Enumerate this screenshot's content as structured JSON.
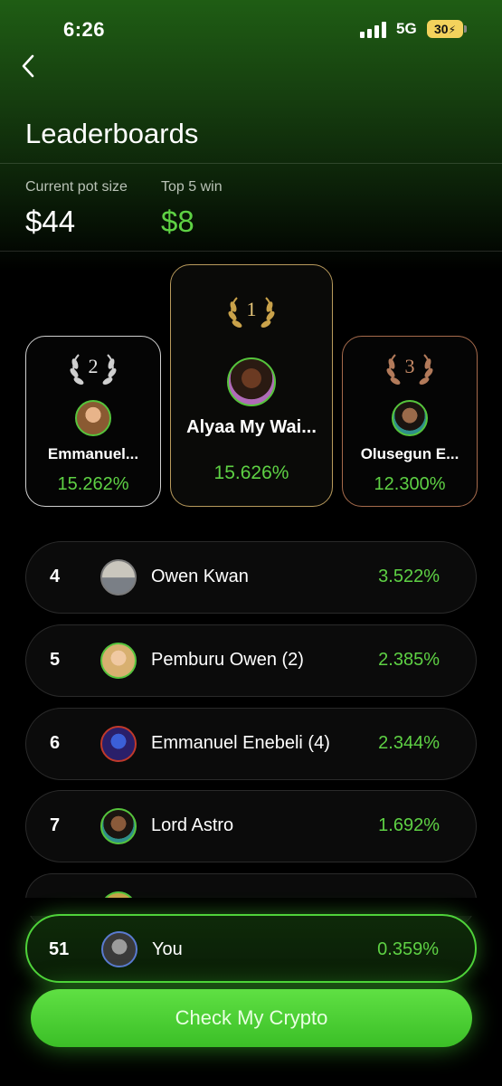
{
  "status_bar": {
    "time": "6:26",
    "network": "5G",
    "battery": "30"
  },
  "header": {
    "title": "Leaderboards"
  },
  "stats": {
    "pot_label": "Current pot size",
    "pot_value": "$44",
    "top5_label": "Top 5 win",
    "top5_value": "$8"
  },
  "podium": [
    {
      "rank": "1",
      "name": "Alyaa My Wai...",
      "pct": "15.626%"
    },
    {
      "rank": "2",
      "name": "Emmanuel...",
      "pct": "15.262%"
    },
    {
      "rank": "3",
      "name": "Olusegun E...",
      "pct": "12.300%"
    }
  ],
  "list": [
    {
      "rank": "4",
      "name": "Owen Kwan",
      "pct": "3.522%"
    },
    {
      "rank": "5",
      "name": "Pemburu Owen (2)",
      "pct": "2.385%"
    },
    {
      "rank": "6",
      "name": "Emmanuel Enebeli (4)",
      "pct": "2.344%"
    },
    {
      "rank": "7",
      "name": "Lord Astro",
      "pct": "1.692%"
    }
  ],
  "you": {
    "rank": "51",
    "name": "You",
    "pct": "0.359%"
  },
  "cta": {
    "label": "Check My Crypto"
  },
  "colors": {
    "accent": "#5ed144",
    "gold": "#b89a5c",
    "silver": "#cfcfcf",
    "bronze": "#a66b4c"
  }
}
